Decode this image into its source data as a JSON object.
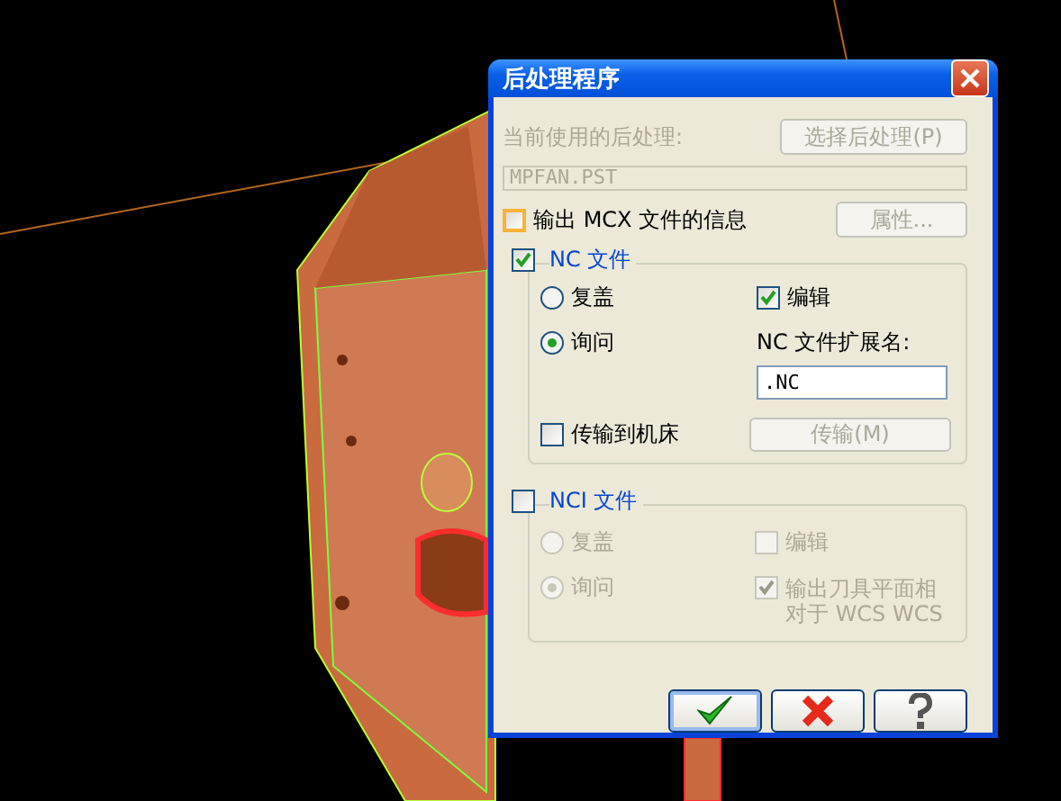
{
  "window": {
    "title": "后处理程序"
  },
  "current_post": {
    "label": "当前使用的后处理:",
    "button": "选择后处理(P)",
    "value": "MPFAN.PST",
    "disabled": true
  },
  "mcx_info": {
    "label": "输出 MCX 文件的信息",
    "checked": false,
    "button": "属性...",
    "button_disabled": true
  },
  "nc_file": {
    "label": "NC 文件",
    "checked": true,
    "disabled": false,
    "options": [
      {
        "label": "复盖",
        "selected": false
      },
      {
        "label": "询问",
        "selected": true
      }
    ],
    "edit": {
      "label": "编辑",
      "checked": true
    },
    "extension_label": "NC 文件扩展名:",
    "extension": ".NC",
    "send": {
      "label": "传输到机床",
      "checked": false
    },
    "send_button": "传输(M)"
  },
  "nci_file": {
    "label": "NCI 文件",
    "checked": false,
    "disabled": true,
    "options": [
      {
        "label": "复盖",
        "selected": false
      },
      {
        "label": "询问",
        "selected": true
      }
    ],
    "edit": {
      "label": "编辑",
      "checked": false
    },
    "output_planes": {
      "label": "输出刀具平面相对于 WCS WCS",
      "checked": true
    }
  },
  "buttons": [
    {
      "kind": "ok"
    },
    {
      "kind": "cancel"
    },
    {
      "kind": "help"
    }
  ]
}
